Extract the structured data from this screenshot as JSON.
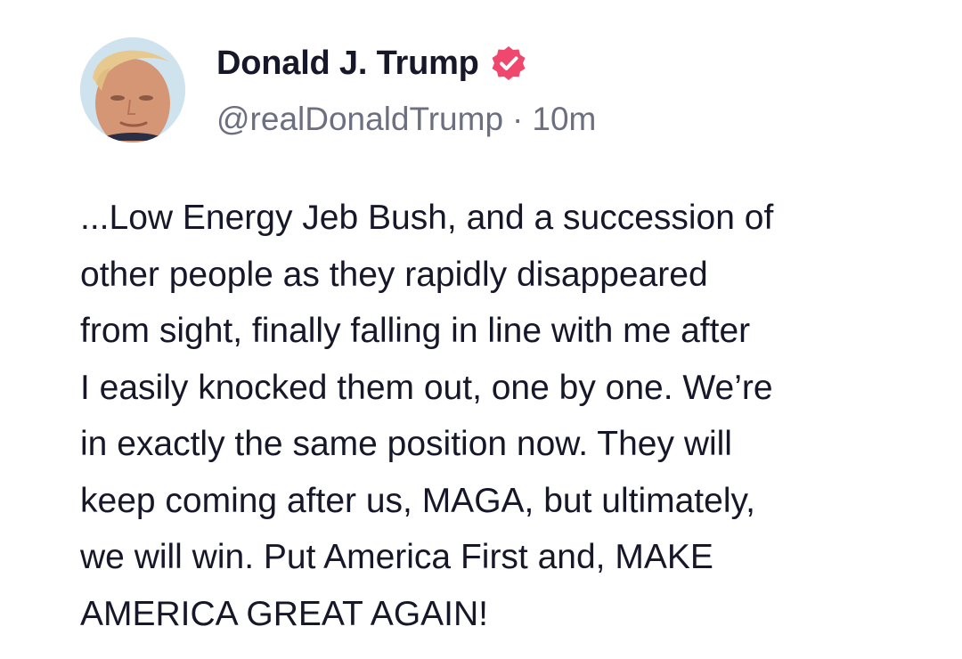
{
  "post": {
    "author": {
      "display_name": "Donald J. Trump",
      "handle": "@realDonaldTrump",
      "verified_icon": "verified-badge-icon",
      "avatar": "profile-photo"
    },
    "meta_separator": "·",
    "timestamp": "10m",
    "body_lines": [
      "...Low Energy Jeb Bush, and a succession of",
      "other people as they rapidly disappeared",
      "from sight, finally falling in line with me after",
      "I easily knocked them out, one by one. We’re",
      "in exactly the same position now. They will",
      "keep coming after us, MAGA, but ultimately,",
      "we will win. Put America First and, MAKE",
      "AMERICA GREAT AGAIN!"
    ]
  },
  "colors": {
    "badge": "#f0476e",
    "text": "#17172a",
    "meta": "#6c6f80",
    "background": "#ffffff"
  }
}
